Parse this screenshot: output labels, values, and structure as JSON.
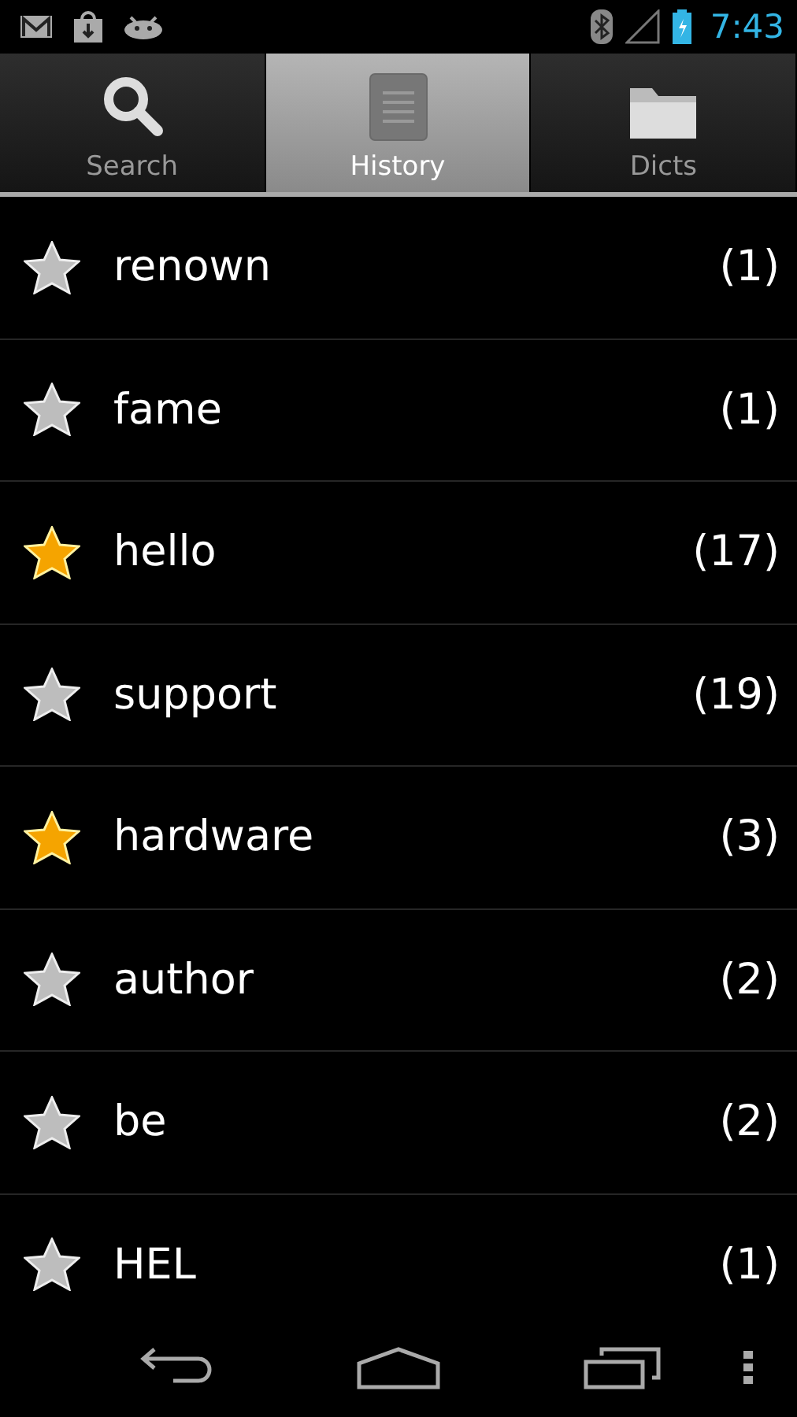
{
  "status_bar": {
    "time": "7:43"
  },
  "tabs": [
    {
      "label": "Search",
      "kind": "search",
      "selected": false
    },
    {
      "label": "History",
      "kind": "list",
      "selected": true
    },
    {
      "label": "Dicts",
      "kind": "folder",
      "selected": false
    }
  ],
  "history": [
    {
      "word": "renown",
      "count": "(1)",
      "starred": false
    },
    {
      "word": "fame",
      "count": "(1)",
      "starred": false
    },
    {
      "word": "hello",
      "count": "(17)",
      "starred": true
    },
    {
      "word": "support",
      "count": "(19)",
      "starred": false
    },
    {
      "word": "hardware",
      "count": "(3)",
      "starred": true
    },
    {
      "word": "author",
      "count": "(2)",
      "starred": false
    },
    {
      "word": "be",
      "count": "(2)",
      "starred": false
    },
    {
      "word": "HEL",
      "count": "(1)",
      "starred": false
    }
  ]
}
